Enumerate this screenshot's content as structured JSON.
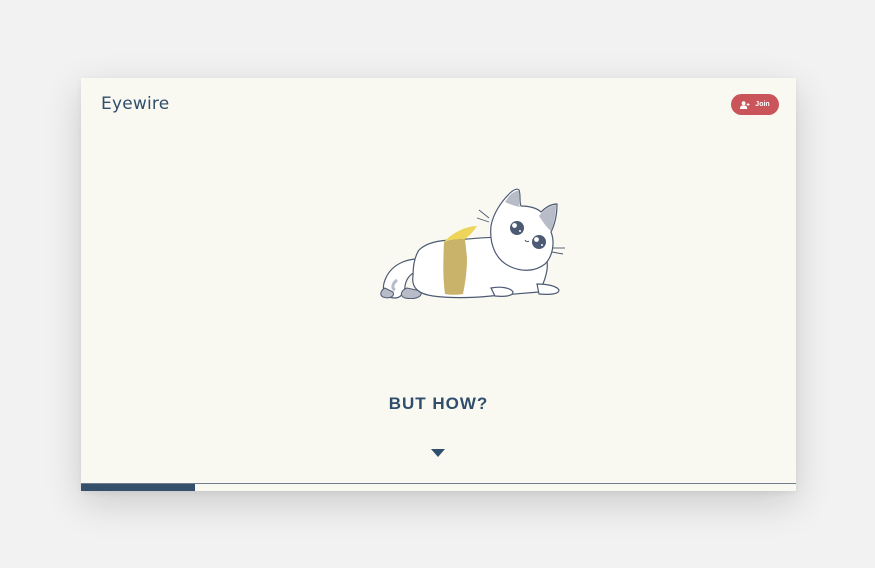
{
  "header": {
    "logo_text": "Eyewire",
    "join_label": "Join",
    "join_icon": "user-plus-icon"
  },
  "hero": {
    "illustration": "cat-lying-illustration",
    "headline": "BUT HOW?",
    "scroll_icon": "triangle-down-icon"
  },
  "progress": {
    "fraction": 0.16
  },
  "colors": {
    "background": "#f9f8f1",
    "brand_text": "#2f4e6b",
    "join_button": "#c9545a",
    "progress": "#34506b",
    "cat_stripe": "#c9b26a",
    "cat_highlight": "#ecd55a"
  }
}
